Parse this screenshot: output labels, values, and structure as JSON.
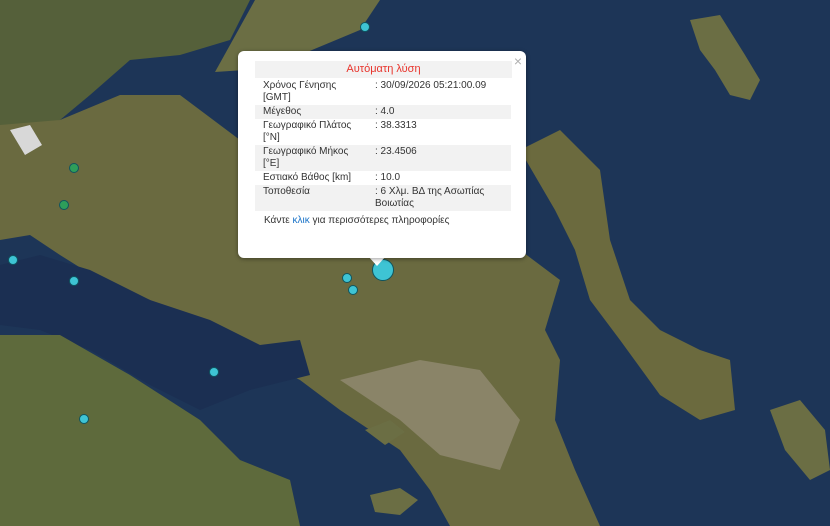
{
  "popup": {
    "title": "Αυτόματη λύση",
    "close_icon": "×",
    "rows": [
      {
        "label": "Χρόνος Γένησης [GMT]",
        "value": ": 30/09/2026 05:21:00.09"
      },
      {
        "label": "Μέγεθος",
        "value": ": 4.0"
      },
      {
        "label": "Γεωγραφικό Πλάτος [°N]",
        "value": ": 38.3313"
      },
      {
        "label": "Γεωγραφικό Μήκος [°E]",
        "value": ": 23.4506"
      },
      {
        "label": "Εστιακό Βάθος [km]",
        "value": ": 10.0"
      },
      {
        "label": "Τοποθεσία",
        "value": ": 6 Χλμ. ΒΔ της Ασωπίας Βοιωτίας"
      }
    ],
    "more_prefix": "Κάντε ",
    "more_link": "κλικ",
    "more_suffix": " για περισσότερες πληροφορίες"
  },
  "colors": {
    "sea": "#1d3557",
    "land": "#5e6a3c",
    "marker_cyan": "#3ec4d4",
    "marker_green": "#2e9e5a",
    "title_red": "#e8342c",
    "link_blue": "#1a73c8"
  }
}
